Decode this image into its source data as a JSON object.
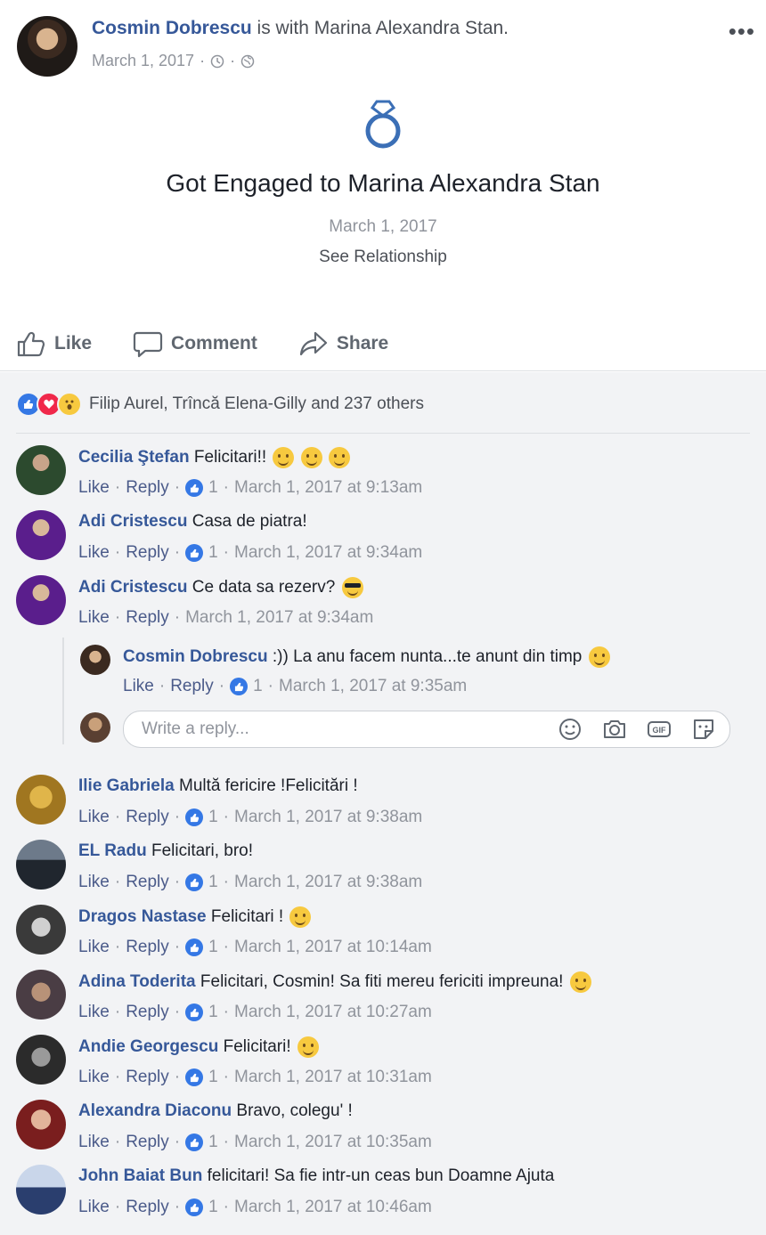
{
  "post": {
    "author": "Cosmin Dobrescu",
    "with_text": " is with ",
    "with_name": "Marina Alexandra Stan.",
    "date": "March 1, 2017",
    "meta_sep": "·"
  },
  "event": {
    "title": "Got Engaged to Marina Alexandra Stan",
    "date": "March 1, 2017",
    "link": "See Relationship"
  },
  "actions": {
    "like": "Like",
    "comment": "Comment",
    "share": "Share"
  },
  "reactions": {
    "summary": "Filip Aurel, Trîncă Elena-Gilly and 237 others"
  },
  "labels": {
    "like": "Like",
    "reply": "Reply",
    "dot": "·"
  },
  "comments": [
    {
      "name": "Cecilia Ştefan",
      "text": "Felicitari!!",
      "likes": "1",
      "time": "March 1, 2017 at 9:13am"
    },
    {
      "name": "Adi Cristescu",
      "text": "Casa de piatra!",
      "likes": "1",
      "time": "March 1, 2017 at 9:34am"
    },
    {
      "name": "Adi Cristescu",
      "text": "Ce data sa rezerv?",
      "likes": "",
      "time": "March 1, 2017 at 9:34am"
    },
    {
      "name": "Ilie Gabriela",
      "text": "Multă fericire !Felicitări !",
      "likes": "1",
      "time": "March 1, 2017 at 9:38am"
    },
    {
      "name": "EL Radu",
      "text": "Felicitari, bro!",
      "likes": "1",
      "time": "March 1, 2017 at 9:38am"
    },
    {
      "name": "Dragos Nastase",
      "text": "Felicitari !",
      "likes": "1",
      "time": "March 1, 2017 at 10:14am"
    },
    {
      "name": "Adina Toderita",
      "text": "Felicitari, Cosmin! Sa fiti mereu fericiti impreuna!",
      "likes": "1",
      "time": "March 1, 2017 at 10:27am"
    },
    {
      "name": "Andie Georgescu",
      "text": "Felicitari!",
      "likes": "1",
      "time": "March 1, 2017 at 10:31am"
    },
    {
      "name": "Alexandra Diaconu",
      "text": "Bravo, colegu' !",
      "likes": "1",
      "time": "March 1, 2017 at 10:35am"
    },
    {
      "name": "John Baiat Bun",
      "text": "felicitari! Sa fie intr-un ceas bun Doamne Ajuta",
      "likes": "1",
      "time": "March 1, 2017 at 10:46am"
    }
  ],
  "reply": {
    "name": "Cosmin Dobrescu",
    "text": ":)) La anu facem nunta...te anunt din timp",
    "likes": "1",
    "time": "March 1, 2017 at 9:35am"
  },
  "write_reply": {
    "placeholder": "Write a reply..."
  },
  "colors": {
    "link": "#365899",
    "muted": "#90949c",
    "like_blue": "#3578e5",
    "love_red": "#f0284a",
    "wow_yellow": "#f7c93f"
  }
}
